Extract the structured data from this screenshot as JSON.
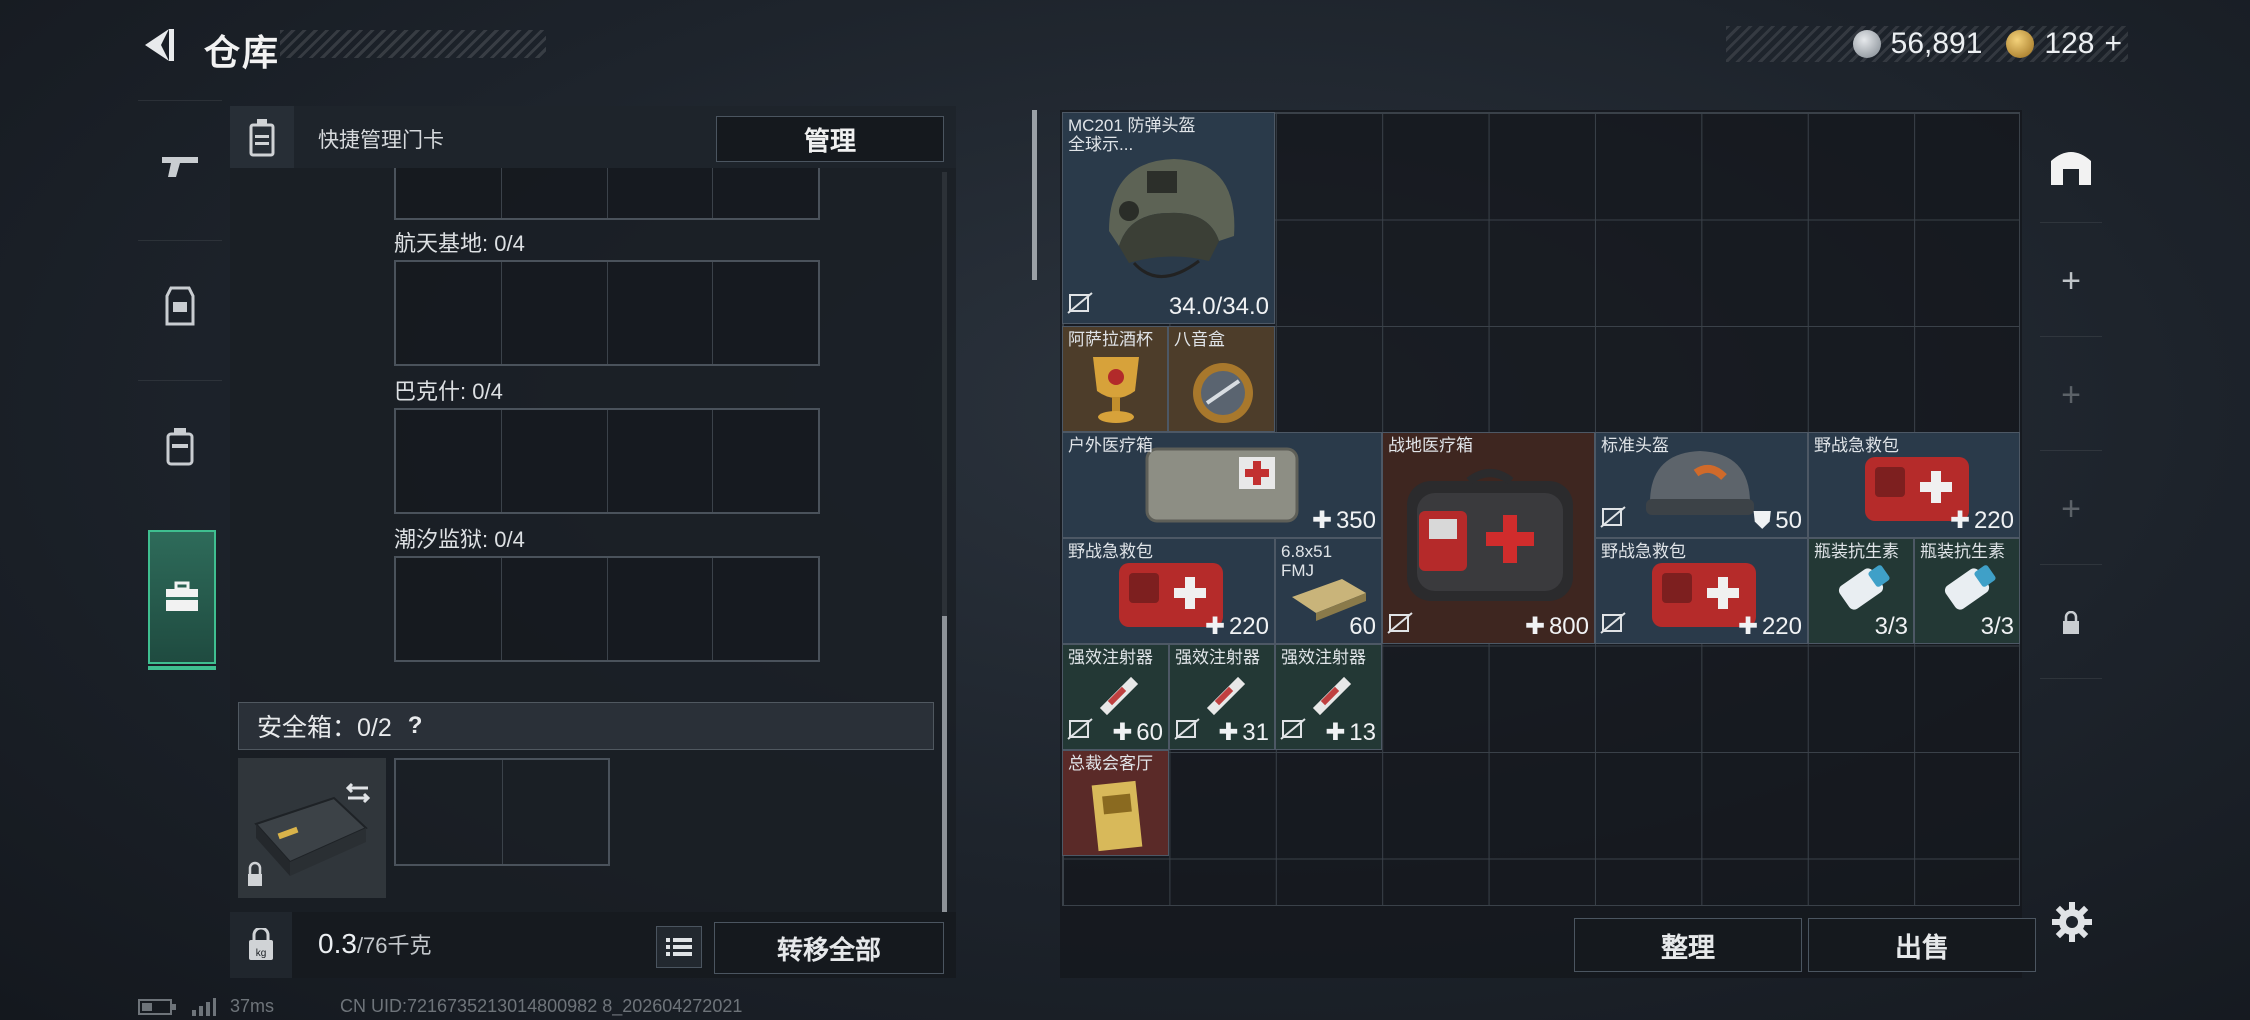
{
  "header": {
    "title": "仓库"
  },
  "currency": {
    "silver": "56,891",
    "gold": "128",
    "gold_add": "+"
  },
  "card_panel": {
    "title": "快捷管理门卡",
    "manage_label": "管理",
    "sections": [
      {
        "label": "航天基地: 0/4"
      },
      {
        "label": "巴克什: 0/4"
      },
      {
        "label": "潮汐监狱: 0/4"
      }
    ]
  },
  "safe_box": {
    "label": "安全箱：0/2",
    "help": "?"
  },
  "footer": {
    "weight": "0.3",
    "capacity": "/76千克",
    "transfer_label": "转移全部"
  },
  "items": [
    {
      "name": "MC201 防弹头盔\n全球示...",
      "value": "34.0/34.0"
    },
    {
      "name": "阿萨拉酒杯",
      "value": ""
    },
    {
      "name": "八音盒",
      "value": ""
    },
    {
      "name": "户外医疗箱",
      "value": "350"
    },
    {
      "name": "战地医疗箱",
      "value": "800"
    },
    {
      "name": "标准头盔",
      "value": "50"
    },
    {
      "name": "野战急救包",
      "value": "220"
    },
    {
      "name": "野战急救包",
      "value": "220"
    },
    {
      "name": "6.8x51\nFMJ",
      "value": "60"
    },
    {
      "name": "野战急救包",
      "value": "220"
    },
    {
      "name": "瓶装抗生素",
      "value": "3/3"
    },
    {
      "name": "瓶装抗生素",
      "value": "3/3"
    },
    {
      "name": "强效注射器",
      "value": "60"
    },
    {
      "name": "强效注射器",
      "value": "31"
    },
    {
      "name": "强效注射器",
      "value": "13"
    },
    {
      "name": "总裁会客厅",
      "value": ""
    }
  ],
  "actions": {
    "sort_label": "整理",
    "sell_label": "出售"
  },
  "status": {
    "ping": "37ms",
    "uid": "CN UID:7216735213014800982 8_202604272021"
  },
  "colors": {
    "accent": "#3fbf90",
    "item_blue": "#2a3a4a",
    "item_red": "#3e2620"
  }
}
